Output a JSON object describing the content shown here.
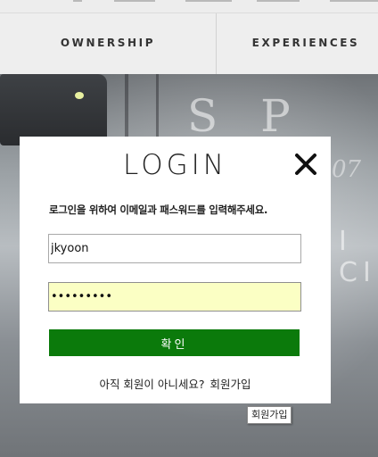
{
  "nav": {
    "items": [
      {
        "label": "OWNERSHIP"
      },
      {
        "label": "EXPERIENCES"
      }
    ]
  },
  "hero": {
    "headline": "S P E C",
    "subline": "I CI",
    "italic": "07"
  },
  "modal": {
    "title": "LOGIN",
    "close_icon": "close-icon",
    "instruction": "로그인을 위하여 이메일과 패스워드를 입력해주세요.",
    "email_value": "jkyoon",
    "password_value": "•••••••••",
    "submit_label": "확인",
    "signup_prompt": "아직 회원이 아니세요?",
    "signup_link": "회원가입"
  },
  "tooltip": {
    "text": "회원가입"
  },
  "colors": {
    "submit_bg": "#0b7a0b",
    "password_autofill_bg": "#fbffc4"
  }
}
